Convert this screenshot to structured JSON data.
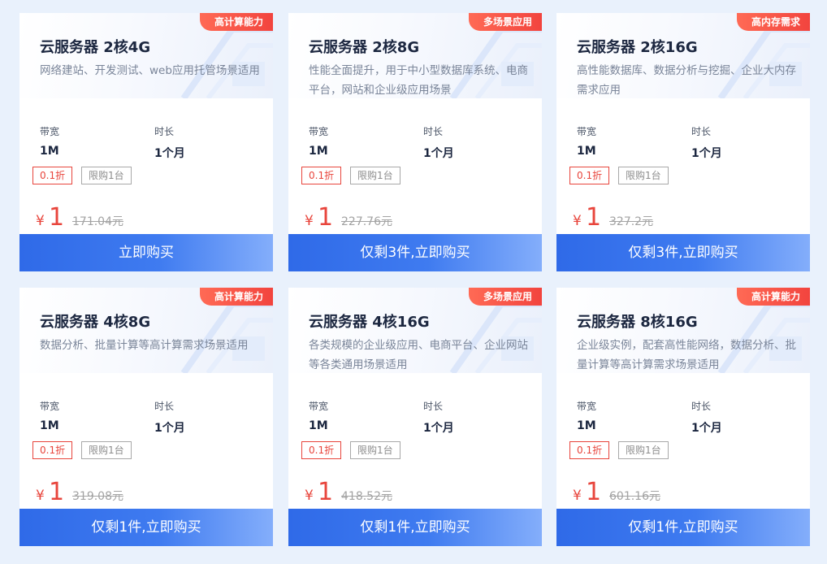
{
  "products": [
    {
      "badge": "高计算能力",
      "title": "云服务器 2核4G",
      "description": "网络建站、开发测试、web应用托管场景适用",
      "bandwidth_label": "带宽",
      "bandwidth_value": "1M",
      "duration_label": "时长",
      "duration_value": "1个月",
      "discount_tag": "0.1折",
      "limit_tag": "限购1台",
      "currency": "¥",
      "price": "1",
      "original_price": "171.04元",
      "button_label": "立即购买"
    },
    {
      "badge": "多场景应用",
      "title": "云服务器 2核8G",
      "description": "性能全面提升，用于中小型数据库系统、电商平台，网站和企业级应用场景",
      "bandwidth_label": "带宽",
      "bandwidth_value": "1M",
      "duration_label": "时长",
      "duration_value": "1个月",
      "discount_tag": "0.1折",
      "limit_tag": "限购1台",
      "currency": "¥",
      "price": "1",
      "original_price": "227.76元",
      "button_label": "仅剩3件,立即购买"
    },
    {
      "badge": "高内存需求",
      "title": "云服务器 2核16G",
      "description": "高性能数据库、数据分析与挖掘、企业大内存需求应用",
      "bandwidth_label": "带宽",
      "bandwidth_value": "1M",
      "duration_label": "时长",
      "duration_value": "1个月",
      "discount_tag": "0.1折",
      "limit_tag": "限购1台",
      "currency": "¥",
      "price": "1",
      "original_price": "327.2元",
      "button_label": "仅剩3件,立即购买"
    },
    {
      "badge": "高计算能力",
      "title": "云服务器 4核8G",
      "description": "数据分析、批量计算等高计算需求场景适用",
      "bandwidth_label": "带宽",
      "bandwidth_value": "1M",
      "duration_label": "时长",
      "duration_value": "1个月",
      "discount_tag": "0.1折",
      "limit_tag": "限购1台",
      "currency": "¥",
      "price": "1",
      "original_price": "319.08元",
      "button_label": "仅剩1件,立即购买"
    },
    {
      "badge": "多场景应用",
      "title": "云服务器 4核16G",
      "description": "各类规模的企业级应用、电商平台、企业网站等各类通用场景适用",
      "bandwidth_label": "带宽",
      "bandwidth_value": "1M",
      "duration_label": "时长",
      "duration_value": "1个月",
      "discount_tag": "0.1折",
      "limit_tag": "限购1台",
      "currency": "¥",
      "price": "1",
      "original_price": "418.52元",
      "button_label": "仅剩1件,立即购买"
    },
    {
      "badge": "高计算能力",
      "title": "云服务器 8核16G",
      "description": "企业级实例，配套高性能网络，数据分析、批量计算等高计算需求场景适用",
      "bandwidth_label": "带宽",
      "bandwidth_value": "1M",
      "duration_label": "时长",
      "duration_value": "1个月",
      "discount_tag": "0.1折",
      "limit_tag": "限购1台",
      "currency": "¥",
      "price": "1",
      "original_price": "601.16元",
      "button_label": "仅剩1件,立即购买"
    }
  ]
}
